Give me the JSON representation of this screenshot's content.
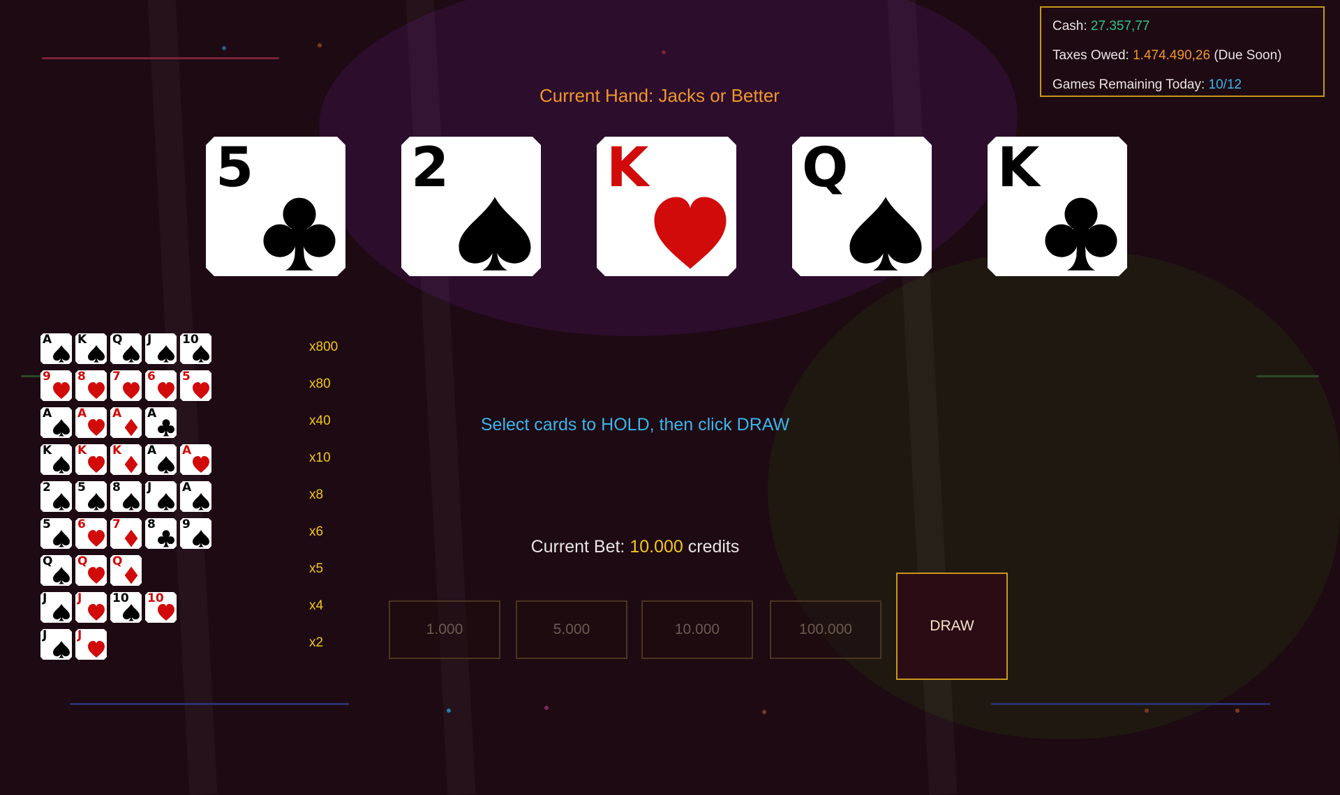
{
  "stats": {
    "cash_label": "Cash: ",
    "cash_value": "27.357,77",
    "taxes_label": "Taxes Owed: ",
    "taxes_value": "1.474.490,26",
    "taxes_note": " (Due Soon)",
    "games_label": "Games Remaining Today: ",
    "games_value": "10/12"
  },
  "current_hand": "Current Hand: Jacks or Better",
  "hand": [
    {
      "rank": "5",
      "suit": "club",
      "color": "black"
    },
    {
      "rank": "2",
      "suit": "spade",
      "color": "black"
    },
    {
      "rank": "K",
      "suit": "heart",
      "color": "red"
    },
    {
      "rank": "Q",
      "suit": "spade",
      "color": "black"
    },
    {
      "rank": "K",
      "suit": "club",
      "color": "black"
    }
  ],
  "paytable": [
    {
      "multiplier": "x800",
      "cards": [
        [
          "A",
          "spade"
        ],
        [
          "K",
          "spade"
        ],
        [
          "Q",
          "spade"
        ],
        [
          "J",
          "spade"
        ],
        [
          "10",
          "spade"
        ]
      ]
    },
    {
      "multiplier": "x80",
      "cards": [
        [
          "9",
          "heart"
        ],
        [
          "8",
          "heart"
        ],
        [
          "7",
          "heart"
        ],
        [
          "6",
          "heart"
        ],
        [
          "5",
          "heart"
        ]
      ]
    },
    {
      "multiplier": "x40",
      "cards": [
        [
          "A",
          "spade"
        ],
        [
          "A",
          "heart"
        ],
        [
          "A",
          "diamond"
        ],
        [
          "A",
          "club"
        ]
      ]
    },
    {
      "multiplier": "x10",
      "cards": [
        [
          "K",
          "spade"
        ],
        [
          "K",
          "heart"
        ],
        [
          "K",
          "diamond"
        ],
        [
          "A",
          "spade"
        ],
        [
          "A",
          "heart"
        ]
      ]
    },
    {
      "multiplier": "x8",
      "cards": [
        [
          "2",
          "spade"
        ],
        [
          "5",
          "spade"
        ],
        [
          "8",
          "spade"
        ],
        [
          "J",
          "spade"
        ],
        [
          "A",
          "spade"
        ]
      ]
    },
    {
      "multiplier": "x6",
      "cards": [
        [
          "5",
          "spade"
        ],
        [
          "6",
          "heart"
        ],
        [
          "7",
          "diamond"
        ],
        [
          "8",
          "club"
        ],
        [
          "9",
          "spade"
        ]
      ]
    },
    {
      "multiplier": "x5",
      "cards": [
        [
          "Q",
          "spade"
        ],
        [
          "Q",
          "heart"
        ],
        [
          "Q",
          "diamond"
        ]
      ]
    },
    {
      "multiplier": "x4",
      "cards": [
        [
          "J",
          "spade"
        ],
        [
          "J",
          "heart"
        ],
        [
          "10",
          "spade"
        ],
        [
          "10",
          "heart"
        ]
      ]
    },
    {
      "multiplier": "x2",
      "cards": [
        [
          "J",
          "spade"
        ],
        [
          "J",
          "heart"
        ]
      ]
    }
  ],
  "instruction": "Select cards to HOLD, then click DRAW",
  "bet": {
    "label": "Current Bet: ",
    "value": "10.000",
    "unit": " credits"
  },
  "bet_options": [
    "1.000",
    "5.000",
    "10.000",
    "100.000"
  ],
  "draw_label": "DRAW",
  "colors": {
    "accent_gold": "#c9971c",
    "cash_green": "#2fc48a",
    "orange": "#f0962c",
    "blue": "#3ab6ee",
    "yellow": "#f2c81c",
    "card_red": "#d10a0a"
  }
}
